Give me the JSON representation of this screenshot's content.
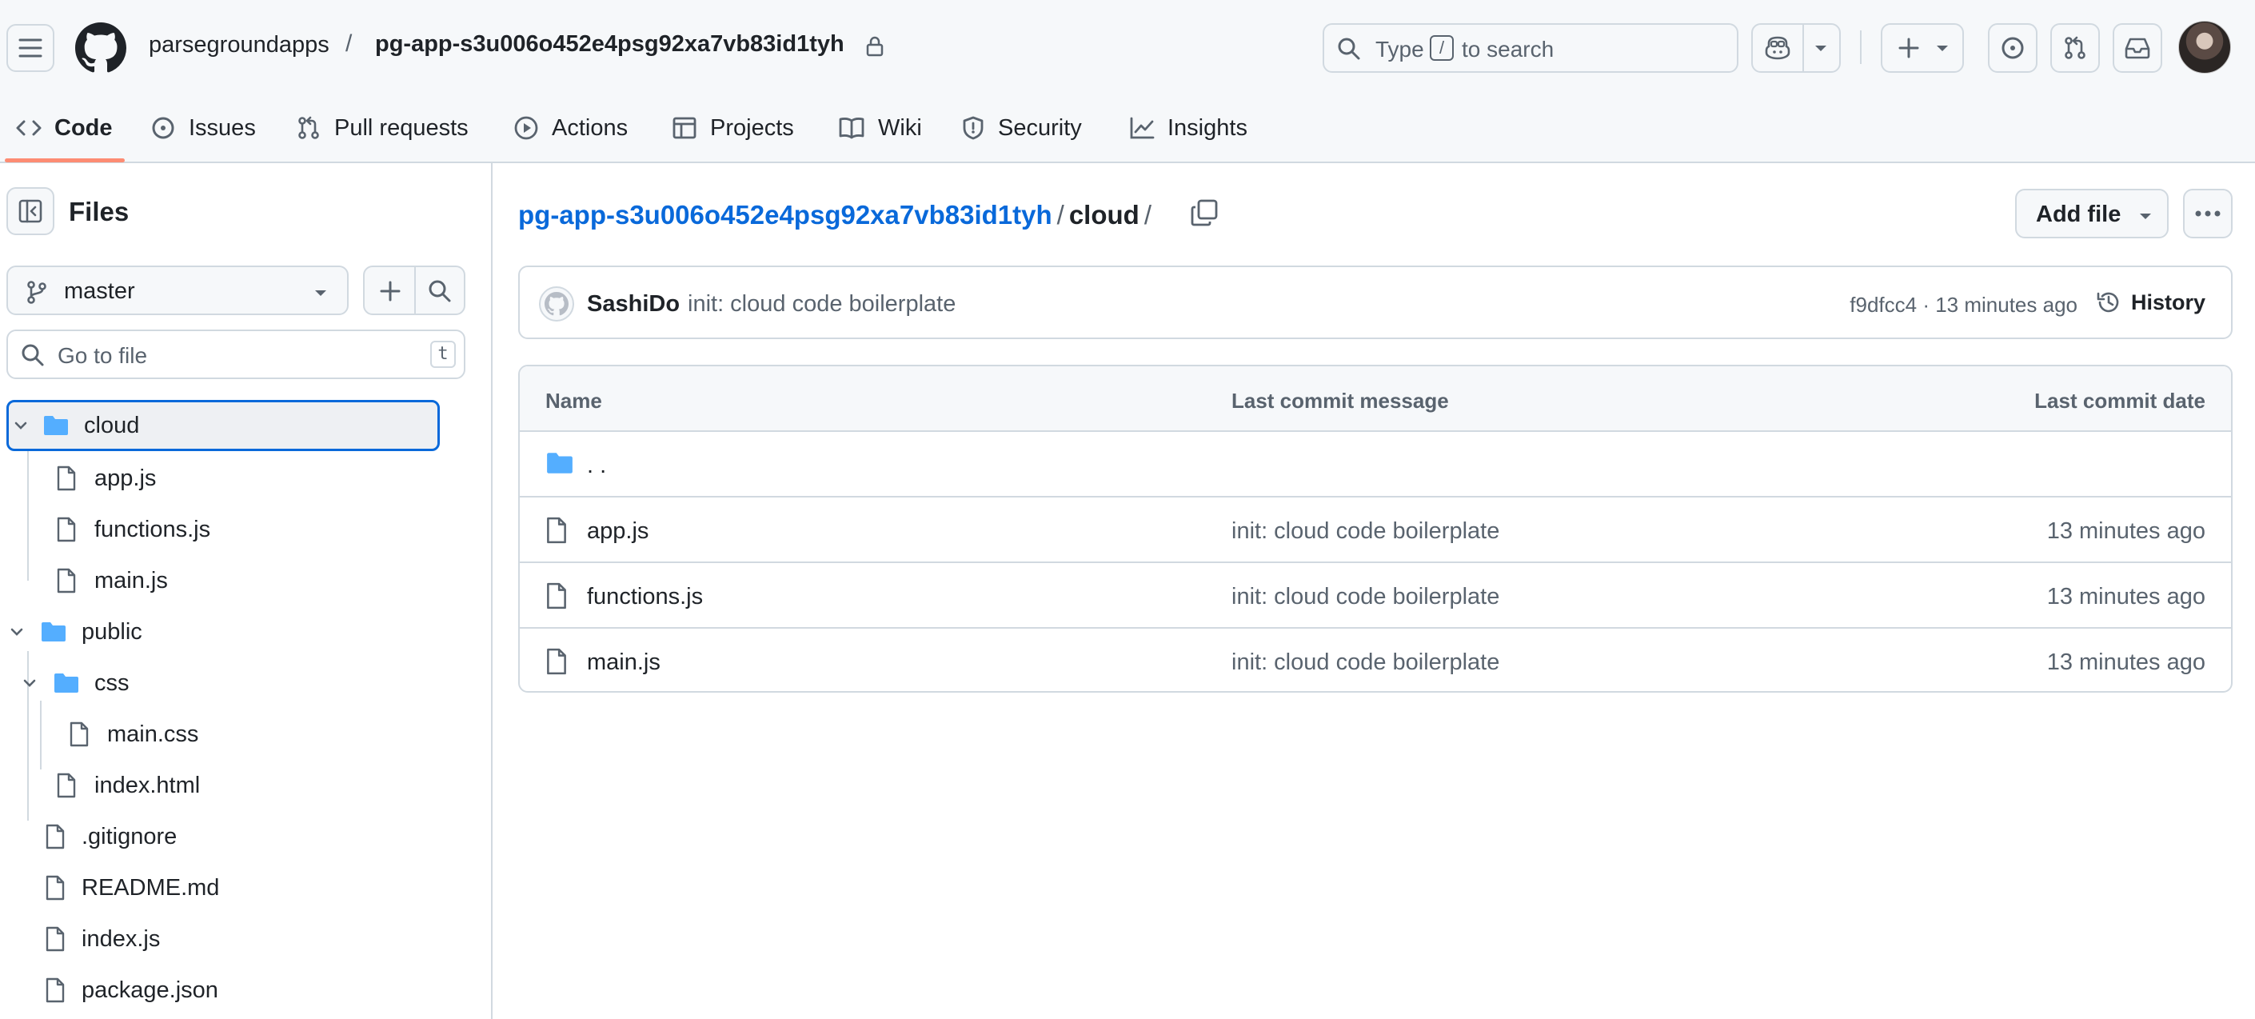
{
  "header": {
    "owner": "parsegroundapps",
    "separator": "/",
    "repo": "pg-app-s3u006o452e4psg92xa7vb83id1tyh",
    "search": {
      "prefix": "Type",
      "key": "/",
      "suffix": "to search"
    }
  },
  "tabs": [
    {
      "label": "Code",
      "icon": "code-icon",
      "active": true
    },
    {
      "label": "Issues",
      "icon": "issue-icon"
    },
    {
      "label": "Pull requests",
      "icon": "pull-request-icon"
    },
    {
      "label": "Actions",
      "icon": "play-icon"
    },
    {
      "label": "Projects",
      "icon": "table-icon"
    },
    {
      "label": "Wiki",
      "icon": "book-icon"
    },
    {
      "label": "Security",
      "icon": "shield-icon"
    },
    {
      "label": "Insights",
      "icon": "graph-icon"
    }
  ],
  "sidebar": {
    "title": "Files",
    "branch": "master",
    "goto_placeholder": "Go to file",
    "goto_shortcut": "t",
    "tree": [
      {
        "label": "cloud",
        "type": "folder",
        "expanded": true,
        "selected": true
      },
      {
        "label": "app.js",
        "type": "file"
      },
      {
        "label": "functions.js",
        "type": "file"
      },
      {
        "label": "main.js",
        "type": "file"
      },
      {
        "label": "public",
        "type": "folder",
        "expanded": true
      },
      {
        "label": "css",
        "type": "folder",
        "expanded": true
      },
      {
        "label": "main.css",
        "type": "file"
      },
      {
        "label": "index.html",
        "type": "file"
      },
      {
        "label": ".gitignore",
        "type": "file"
      },
      {
        "label": "README.md",
        "type": "file"
      },
      {
        "label": "index.js",
        "type": "file"
      },
      {
        "label": "package.json",
        "type": "file"
      }
    ]
  },
  "main": {
    "breadcrumb": {
      "repo": "pg-app-s3u006o452e4psg92xa7vb83id1tyh",
      "sep": "/",
      "dir": "cloud",
      "trail": "/"
    },
    "add_file_label": "Add file",
    "commit": {
      "author": "SashiDo",
      "message": "init: cloud code boilerplate",
      "meta": "f9dfcc4 · 13 minutes ago",
      "history_label": "History"
    },
    "table": {
      "headers": {
        "name": "Name",
        "message": "Last commit message",
        "date": "Last commit date"
      },
      "parent_label": ". .",
      "rows": [
        {
          "name": "app.js",
          "message": "init: cloud code boilerplate",
          "date": "13 minutes ago"
        },
        {
          "name": "functions.js",
          "message": "init: cloud code boilerplate",
          "date": "13 minutes ago"
        },
        {
          "name": "main.js",
          "message": "init: cloud code boilerplate",
          "date": "13 minutes ago"
        }
      ]
    }
  },
  "colors": {
    "link": "#0969da",
    "folder": "#54aeff",
    "tab_underline": "#fd8c73",
    "border": "#d1d9e0"
  }
}
